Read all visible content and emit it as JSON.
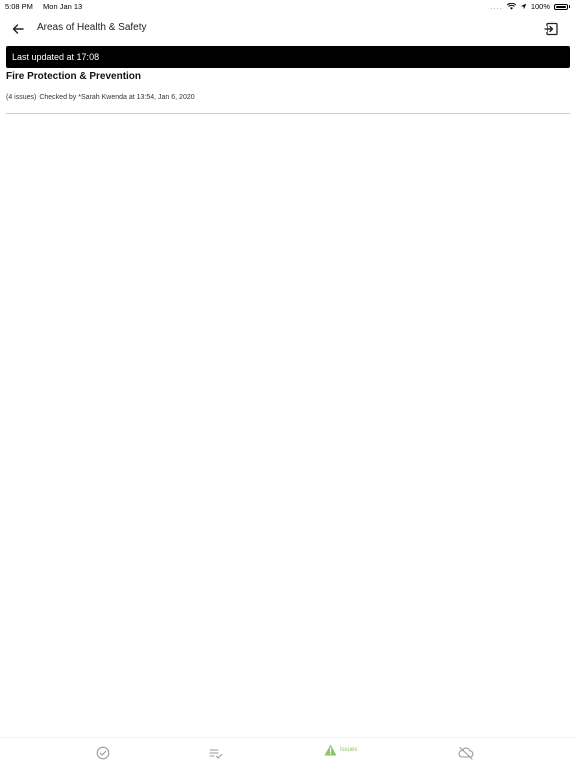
{
  "status_bar": {
    "time": "5:08 PM",
    "date": "Mon Jan 13",
    "dots": "....",
    "battery": "100%"
  },
  "nav": {
    "title": "Areas of Health & Safety",
    "back_icon": "arrow-left-icon",
    "exit_icon": "exit-icon"
  },
  "banner": {
    "text": "Last updated at 17:08"
  },
  "section": {
    "title": "Fire Protection & Prevention",
    "issue_count": "(4 issues)",
    "checked_by": "Checked by *Sarah Kwenda at 13:54, Jan 6, 2020"
  },
  "tabs": [
    {
      "icon": "check-circle-icon",
      "label": ""
    },
    {
      "icon": "list-check-icon",
      "label": ""
    },
    {
      "icon": "warning-triangle-icon",
      "label": "Issues"
    },
    {
      "icon": "cloud-off-icon",
      "label": ""
    }
  ],
  "colors": {
    "banner_bg": "#000000",
    "active_tab": "#8dc36c",
    "inactive_tab": "#9a9a9a"
  }
}
